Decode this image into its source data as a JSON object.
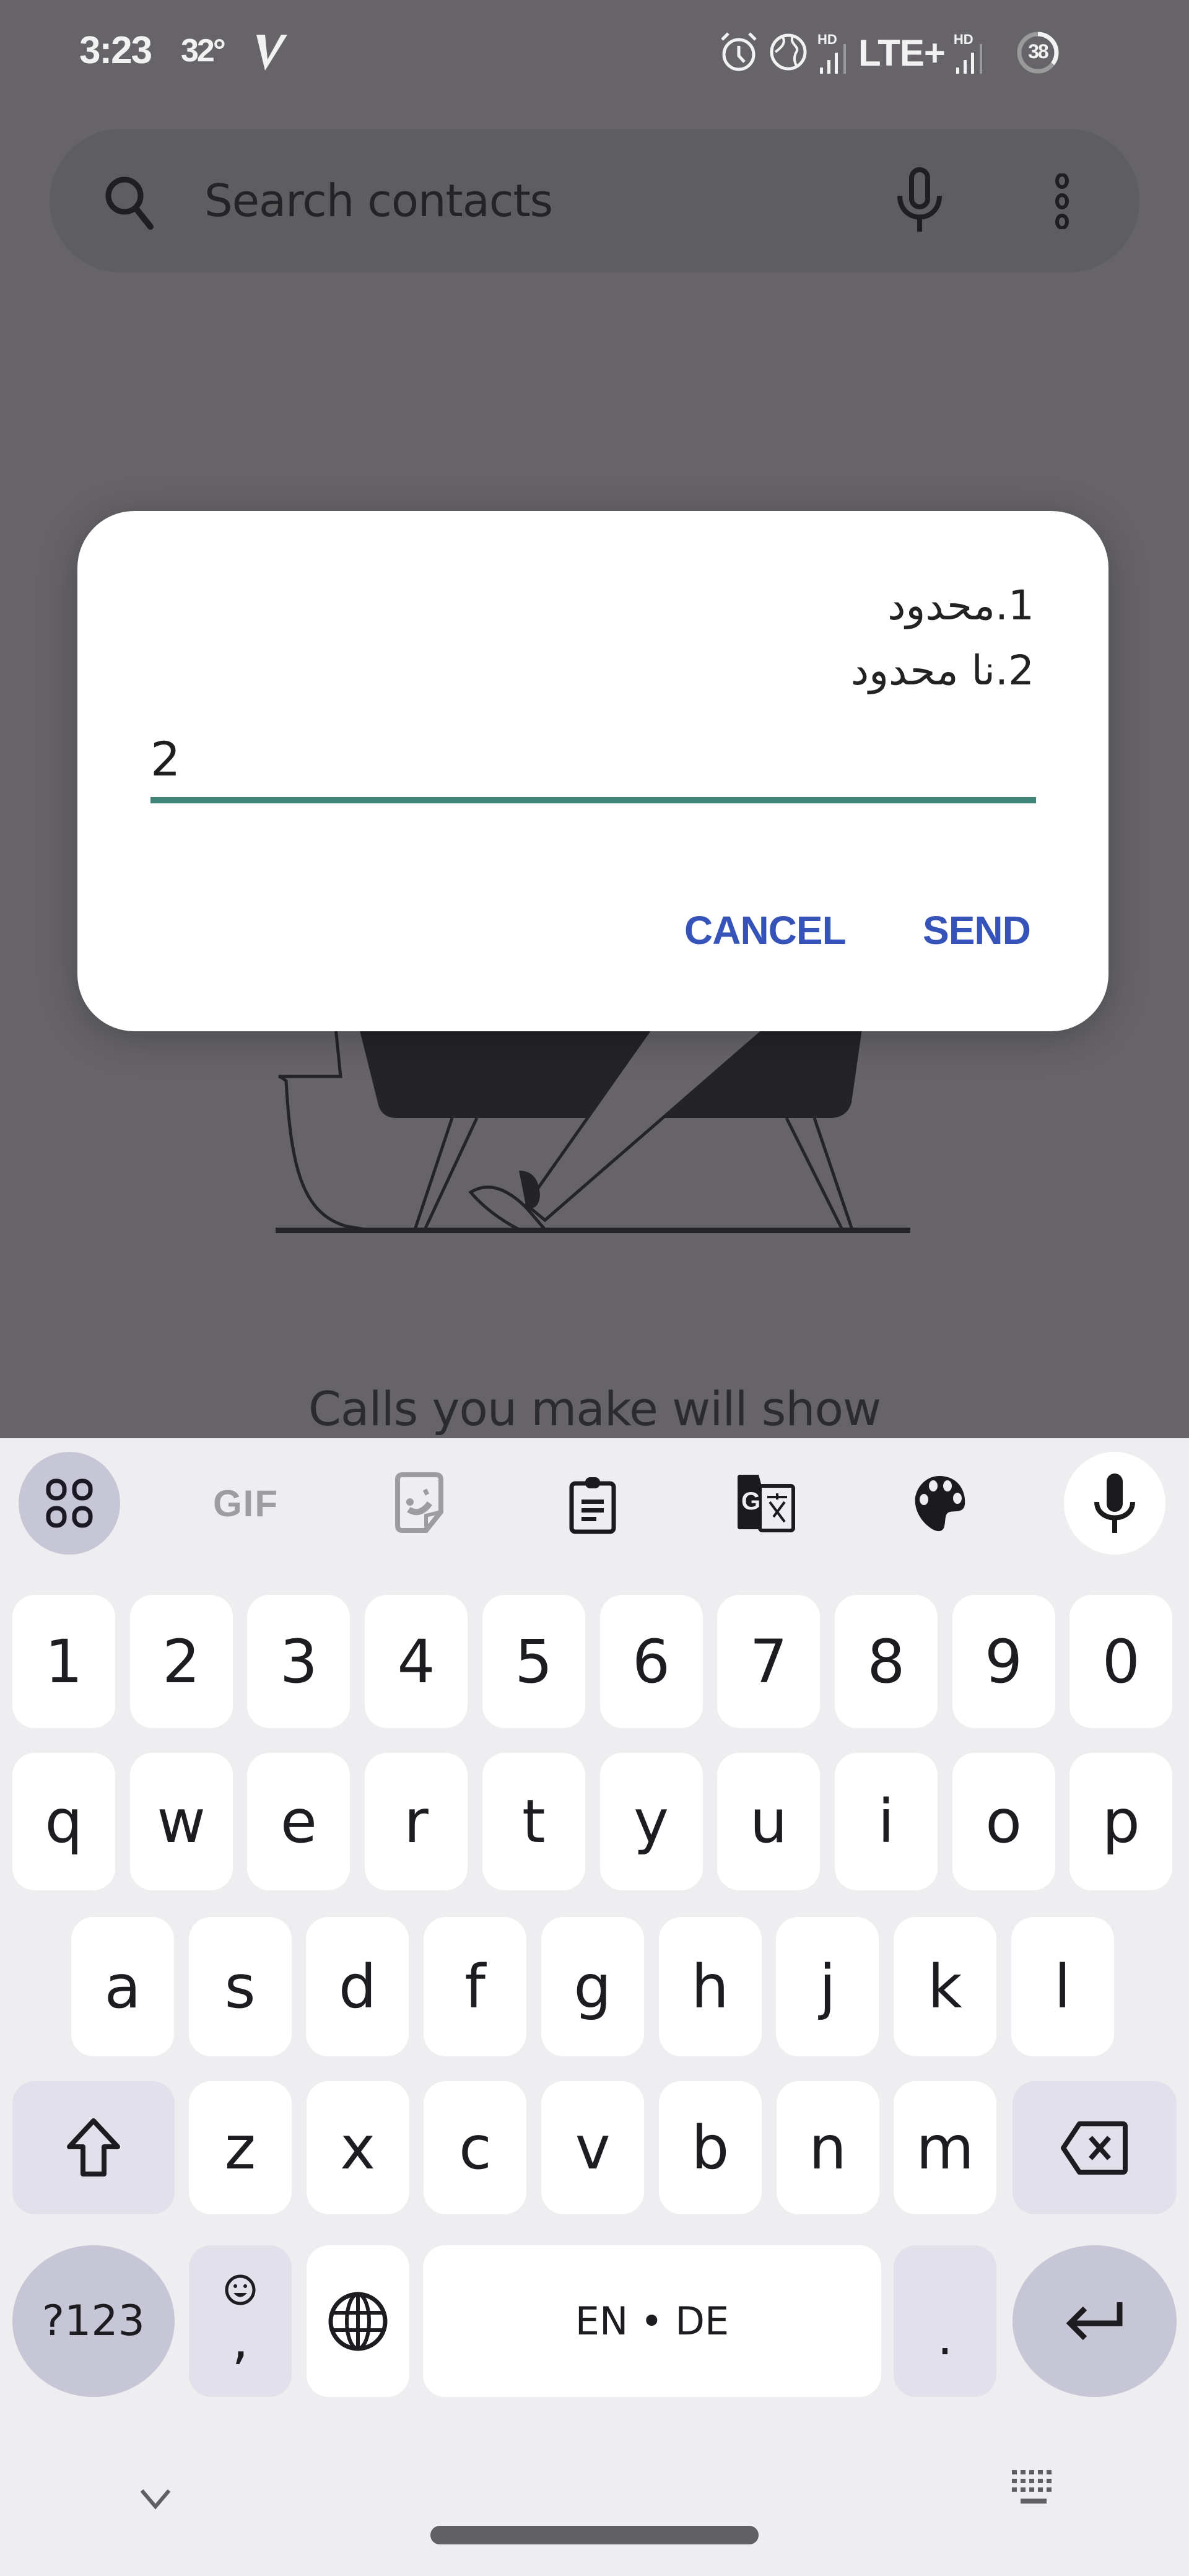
{
  "status_bar": {
    "time": "3:23",
    "temperature": "32°",
    "carrier_icon": "v-logo-icon",
    "network": "LTE+",
    "hd_label_1": "HD",
    "hd_label_2": "HD",
    "battery_percent": "38",
    "icons": [
      "alarm-icon",
      "globe-icon",
      "signal-icon",
      "signal-icon",
      "battery-ring-icon"
    ]
  },
  "search": {
    "placeholder": "Search contacts",
    "icons": [
      "search-icon",
      "mic-icon",
      "more-vert-icon"
    ]
  },
  "background": {
    "empty_state_text": "Calls you make will show"
  },
  "dialog": {
    "message_lines": [
      "1.محدود",
      "2.نا محدود"
    ],
    "input_value": "2",
    "accent_color": "#3f8577",
    "button_color": "#3553b8",
    "cancel_label": "CANCEL",
    "send_label": "SEND"
  },
  "keyboard": {
    "toolbar": [
      "apps-grid-icon",
      "gif",
      "sticker-icon",
      "clipboard-icon",
      "translate-icon",
      "palette-icon",
      "mic-icon"
    ],
    "gif_label": "GIF",
    "number_row": [
      "1",
      "2",
      "3",
      "4",
      "5",
      "6",
      "7",
      "8",
      "9",
      "0"
    ],
    "row1": [
      "q",
      "w",
      "e",
      "r",
      "t",
      "y",
      "u",
      "i",
      "o",
      "p"
    ],
    "row2": [
      "a",
      "s",
      "d",
      "f",
      "g",
      "h",
      "j",
      "k",
      "l"
    ],
    "row3": [
      "z",
      "x",
      "c",
      "v",
      "b",
      "n",
      "m"
    ],
    "symbols_label": "?123",
    "comma_label": ",",
    "space_label": "EN • DE",
    "period_label": ".",
    "nav_icons": [
      "chevron-down-icon",
      "keyboard-icon"
    ]
  }
}
